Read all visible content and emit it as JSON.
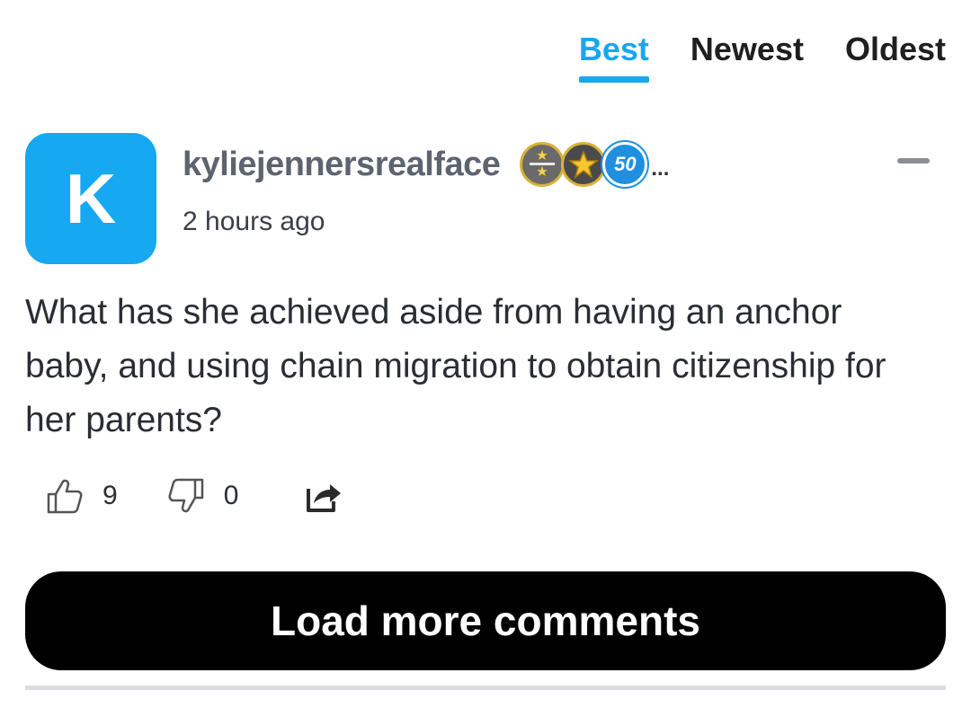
{
  "sort_tabs": [
    {
      "label": "Best",
      "active": true
    },
    {
      "label": "Newest",
      "active": false
    },
    {
      "label": "Oldest",
      "active": false
    }
  ],
  "comment": {
    "avatar_letter": "K",
    "username": "kyliejennersrealface",
    "badge_number": "50",
    "badges_more": "...",
    "timestamp": "2 hours ago",
    "text": "What has she achieved aside from having an anchor baby, and using chain migration to obtain citizenship for her parents?",
    "likes": "9",
    "dislikes": "0"
  },
  "load_more_label": "Load more comments",
  "colors": {
    "accent": "#16a8f0",
    "button_bg": "#000000"
  }
}
